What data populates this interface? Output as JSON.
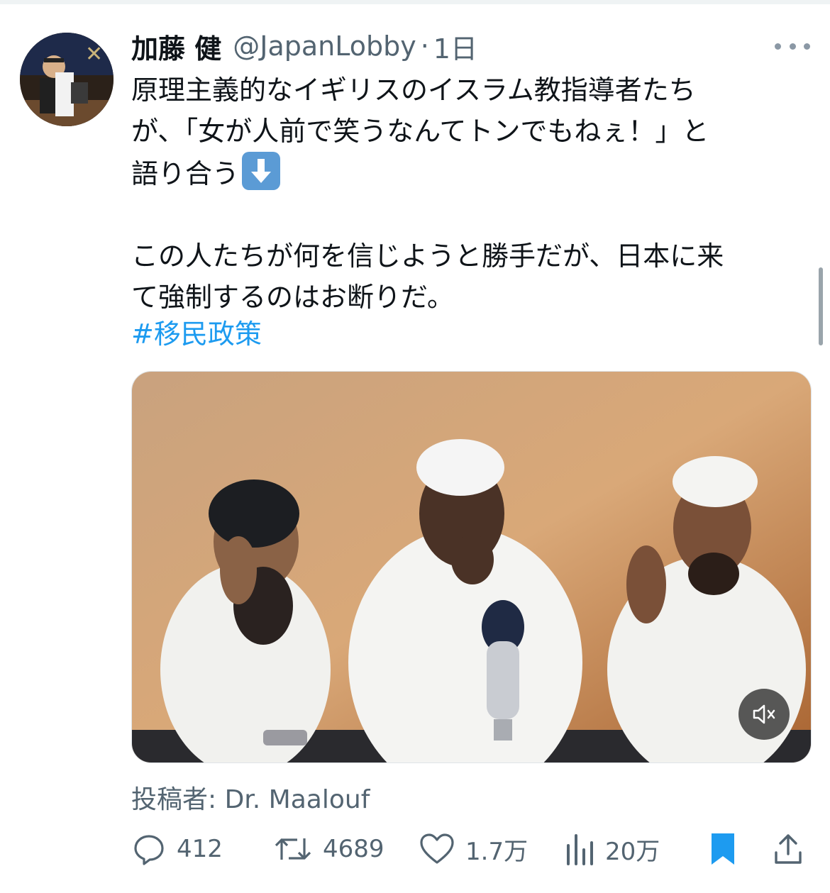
{
  "tweet": {
    "author_name": "加藤 健",
    "author_handle": "@JapanLobby",
    "separator": "·",
    "time": "1日",
    "text": "原理主義的なイギリスのイスラム教指導者たち\nが、「女が人前で笑うなんてトンでもねぇ！」と\n語り合う",
    "text_emoji": "down-arrow-emoji",
    "text2": "この人たちが何を信じようと勝手だが、日本に来\nて強制するのはお断りだ。",
    "hashtag": "#移民政策",
    "byline": "投稿者: Dr. Maalouf"
  },
  "actions": {
    "replies": "412",
    "retweets": "4689",
    "likes": "1.7万",
    "views": "20万"
  },
  "colors": {
    "text": "#0f1419",
    "secondary": "#536471",
    "link": "#1d9bf0",
    "bookmark": "#1d9bf0"
  }
}
